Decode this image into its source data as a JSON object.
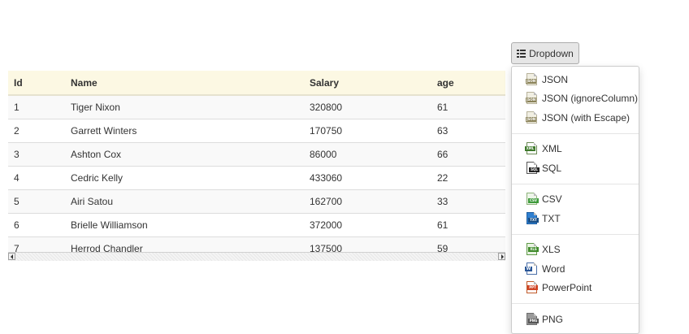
{
  "table": {
    "columns": [
      "Id",
      "Name",
      "Salary",
      "age"
    ],
    "rows": [
      [
        "1",
        "Tiger Nixon",
        "320800",
        "61"
      ],
      [
        "2",
        "Garrett Winters",
        "170750",
        "63"
      ],
      [
        "3",
        "Ashton Cox",
        "86000",
        "66"
      ],
      [
        "4",
        "Cedric Kelly",
        "433060",
        "22"
      ],
      [
        "5",
        "Airi Satou",
        "162700",
        "33"
      ],
      [
        "6",
        "Brielle Williamson",
        "372000",
        "61"
      ],
      [
        "7",
        "Herrod Chandler",
        "137500",
        "59"
      ]
    ]
  },
  "dropdown": {
    "button_label": "Dropdown",
    "groups": [
      [
        {
          "label": "JSON",
          "icon": "json-file-icon",
          "tag": "JSON"
        },
        {
          "label": "JSON (ignoreColumn)",
          "icon": "json-file-icon",
          "tag": "JSON"
        },
        {
          "label": "JSON (with Escape)",
          "icon": "json-file-icon",
          "tag": "JSON"
        }
      ],
      [
        {
          "label": "XML",
          "icon": "xml-file-icon",
          "tag": "XML"
        },
        {
          "label": "SQL",
          "icon": "sql-file-icon",
          "tag": "SQL"
        }
      ],
      [
        {
          "label": "CSV",
          "icon": "csv-file-icon",
          "tag": "CSV"
        },
        {
          "label": "TXT",
          "icon": "txt-file-icon",
          "tag": "TXT"
        }
      ],
      [
        {
          "label": "XLS",
          "icon": "xls-file-icon",
          "tag": "XLS"
        },
        {
          "label": "Word",
          "icon": "word-file-icon",
          "tag": "W"
        },
        {
          "label": "PowerPoint",
          "icon": "powerpoint-file-icon",
          "tag": "PPT"
        }
      ],
      [
        {
          "label": "PNG",
          "icon": "png-file-icon",
          "tag": "PNG"
        }
      ]
    ]
  },
  "colors": {
    "header_bg": "#fcf8e3",
    "row_stripe": "#f9f9f9",
    "button_bg": "#e6e6e6"
  }
}
